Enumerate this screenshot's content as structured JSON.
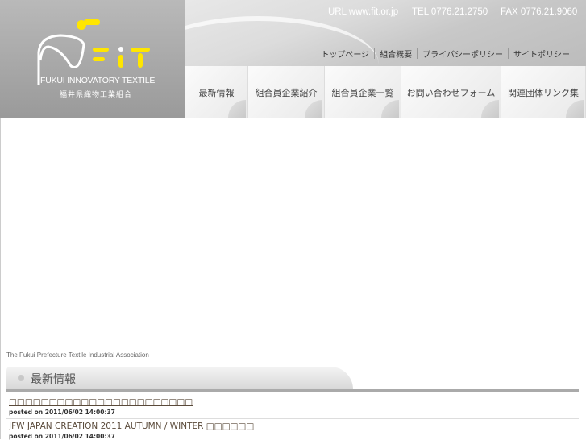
{
  "logo": {
    "name_en": "FUKUI INNOVATORY TEXTILE",
    "name_jp": "福井県織物工業組合",
    "wordmark": "FIT"
  },
  "header": {
    "url": "URL www.fit.or.jp",
    "tel": "TEL  0776.21.2750",
    "fax": "FAX 0776.21.9060"
  },
  "util_nav": [
    "トップページ",
    "組合概要",
    "プライバシーポリシー",
    "サイトポリシー"
  ],
  "main_nav": [
    "最新情報",
    "組合員企業紹介",
    "組合員企業一覧",
    "お問い合わせフォーム",
    "関連団体リンク集"
  ],
  "tagline": "The Fukui Prefecture Textile Industrial Association",
  "section": {
    "title": "最新情報"
  },
  "posts": [
    {
      "title": "□□□□□□□□□□□□□□□□□□□□□□□",
      "meta": "posted on 2011/06/02 14:00:37"
    },
    {
      "title": "JFW JAPAN CREATION 2011 AUTUMN / WINTER □□□□□□",
      "meta": "posted on 2011/06/02 14:00:37"
    }
  ]
}
